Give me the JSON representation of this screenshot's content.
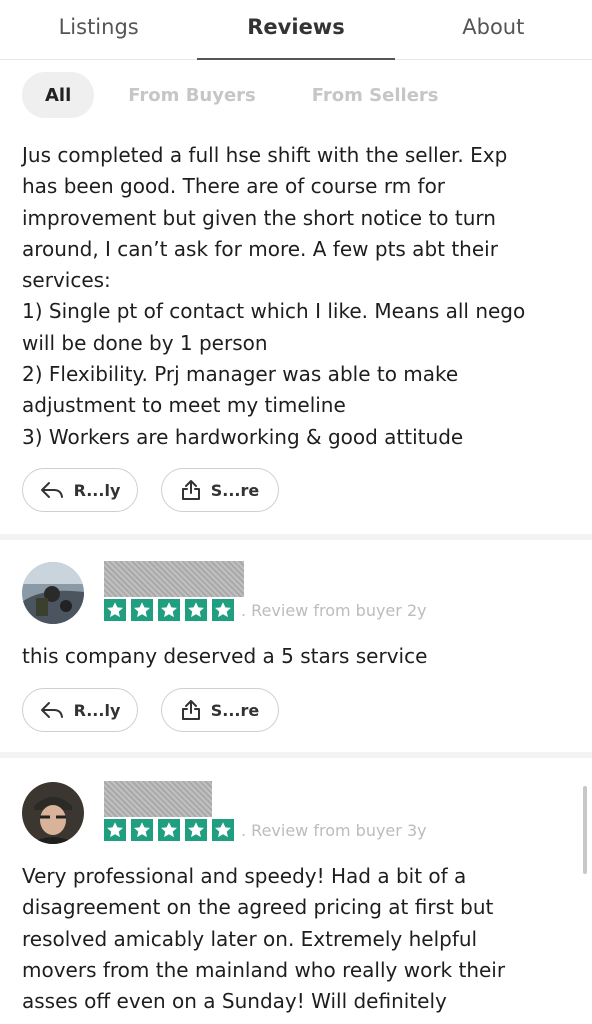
{
  "tabs": [
    {
      "label": "Listings"
    },
    {
      "label": "Reviews"
    },
    {
      "label": "About"
    }
  ],
  "filters": [
    {
      "label": "All"
    },
    {
      "label": "From Buyers"
    },
    {
      "label": "From Sellers"
    }
  ],
  "review1": {
    "lines": [
      "Jus completed a full hse shift with the seller. Exp",
      "has been good. There are of course rm for",
      "improvement but given the short notice to turn",
      "around, I can’t ask for more. A few pts abt their",
      "services:",
      "1) Single pt of contact which I like. Means all nego",
      "will be done by 1 person",
      "2) Flexibility. Prj manager was able to make",
      "adjustment to meet my timeline",
      "3) Workers are hardworking & good attitude"
    ],
    "reply_label": "R...ly",
    "share_label": "S...re"
  },
  "review2": {
    "rating": 5,
    "meta": ". Review from buyer  2y",
    "text": "this company deserved a 5 stars service",
    "reply_label": "R...ly",
    "share_label": "S...re"
  },
  "review3": {
    "rating": 5,
    "meta": ". Review from buyer  3y",
    "lines": [
      "Very professional and speedy! Had a bit of a",
      "disagreement on the agreed pricing at first but",
      "resolved amicably later on. Extremely helpful",
      "movers from the mainland who really work their",
      "asses off even on a Sunday! Will definitely"
    ]
  },
  "colors": {
    "star_green": "#1f9e80",
    "active_tab_underline": "#555555",
    "chip_active_bg": "#efefef"
  },
  "icons": {
    "reply": "reply-arrow-icon",
    "share": "share-upload-icon",
    "star": "star-icon"
  }
}
